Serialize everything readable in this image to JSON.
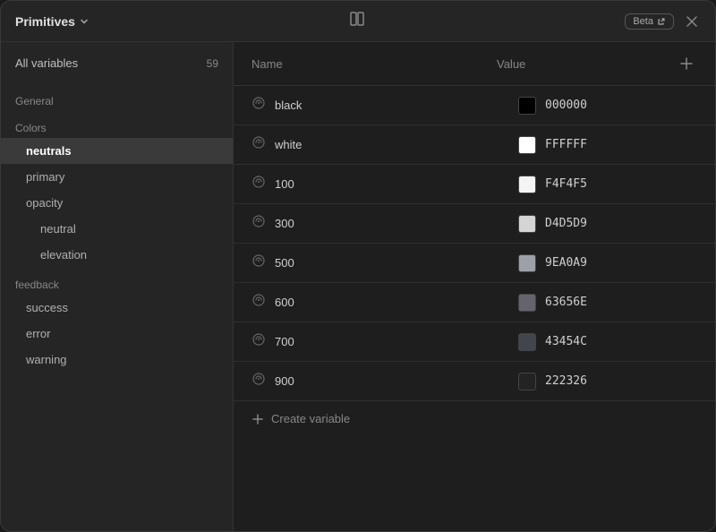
{
  "window": {
    "title": "Primitives",
    "beta_label": "Beta",
    "close_label": "×"
  },
  "sidebar": {
    "all_variables_label": "All variables",
    "all_variables_count": "59",
    "groups": [
      {
        "label": "General",
        "items": []
      },
      {
        "label": "Colors",
        "items": [
          {
            "id": "neutrals",
            "label": "neutrals",
            "active": true,
            "level": "sub"
          },
          {
            "id": "primary",
            "label": "primary",
            "active": false,
            "level": "sub"
          },
          {
            "id": "opacity",
            "label": "opacity",
            "active": false,
            "level": "sub"
          },
          {
            "id": "neutral",
            "label": "neutral",
            "active": false,
            "level": "sub2"
          },
          {
            "id": "elevation",
            "label": "elevation",
            "active": false,
            "level": "sub2"
          }
        ]
      },
      {
        "label": "feedback",
        "items": [
          {
            "id": "success",
            "label": "success",
            "active": false,
            "level": "sub"
          },
          {
            "id": "error",
            "label": "error",
            "active": false,
            "level": "sub"
          },
          {
            "id": "warning",
            "label": "warning",
            "active": false,
            "level": "sub"
          }
        ]
      }
    ]
  },
  "main": {
    "col_name": "Name",
    "col_value": "Value",
    "variables": [
      {
        "id": "black",
        "name": "black",
        "hex": "000000",
        "color": "#000000"
      },
      {
        "id": "white",
        "name": "white",
        "hex": "FFFFFF",
        "color": "#FFFFFF"
      },
      {
        "id": "100",
        "name": "100",
        "hex": "F4F4F5",
        "color": "#F4F4F5"
      },
      {
        "id": "300",
        "name": "300",
        "hex": "D4D5D9",
        "color": "#D4D5D9"
      },
      {
        "id": "500",
        "name": "500",
        "hex": "9EA0A9",
        "color": "#9EA0A9"
      },
      {
        "id": "600",
        "name": "600",
        "hex": "63656E",
        "color": "#63656E"
      },
      {
        "id": "700",
        "name": "700",
        "hex": "43454C",
        "color": "#43454C"
      },
      {
        "id": "900",
        "name": "900",
        "hex": "222326",
        "color": "#222326"
      }
    ],
    "create_variable_label": "Create variable"
  }
}
